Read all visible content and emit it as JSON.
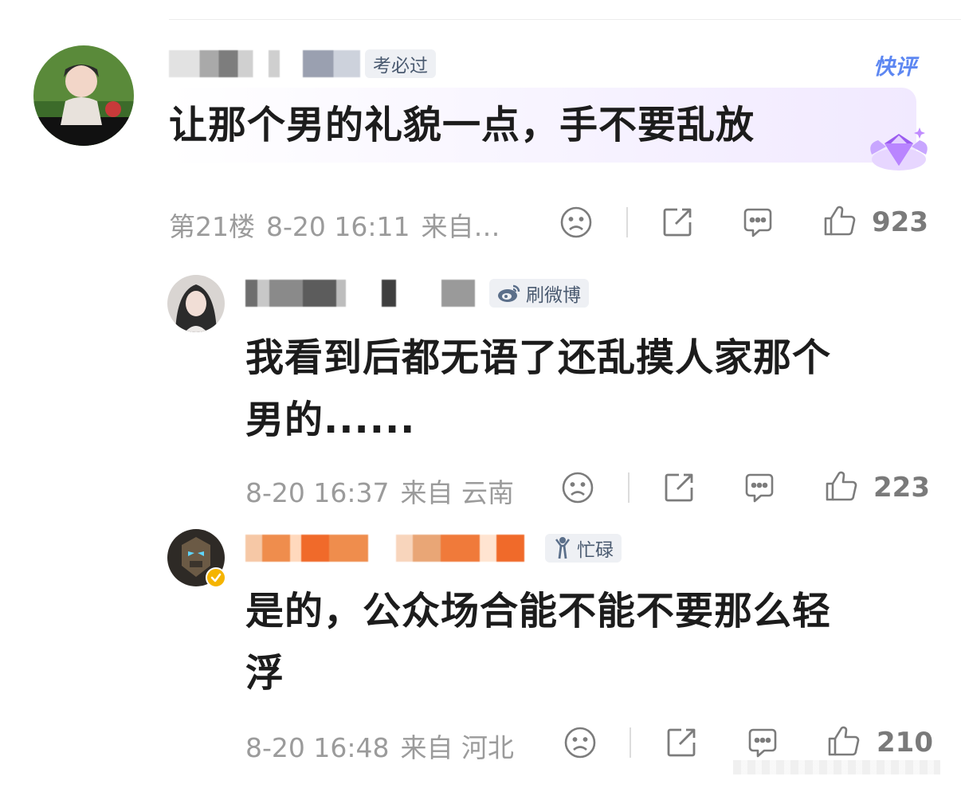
{
  "top_comment": {
    "badge_label": "考必过",
    "quick_review_label": "快评",
    "text": "让那个男的礼貌一点，手不要乱放",
    "meta": {
      "floor": "第21楼",
      "datetime": "8-20 16:11",
      "source": "来自…"
    },
    "like_count": "923"
  },
  "replies": [
    {
      "badge_label": "刷微博",
      "text_line1": "我看到后都无语了还乱摸人家那个",
      "text_line2": "男的......",
      "meta": {
        "datetime": "8-20 16:37",
        "source": "来自 云南"
      },
      "like_count": "223"
    },
    {
      "badge_label": "忙碌",
      "text_line1": "是的，公众场合能不能不要那么轻",
      "text_line2": "浮",
      "meta": {
        "datetime": "8-20 16:48",
        "source": "来自 河北"
      },
      "like_count": "210"
    }
  ],
  "icons": [
    "sad-face-icon",
    "share-icon",
    "comment-icon",
    "thumbs-up-icon",
    "verified-badge-icon",
    "weibo-logo-icon",
    "gem-icon"
  ],
  "colors": {
    "accent": "#5d87f2",
    "meta_text": "#9b9b9b",
    "verified": "#f5b400",
    "badge_bg": "#eef0f4"
  }
}
